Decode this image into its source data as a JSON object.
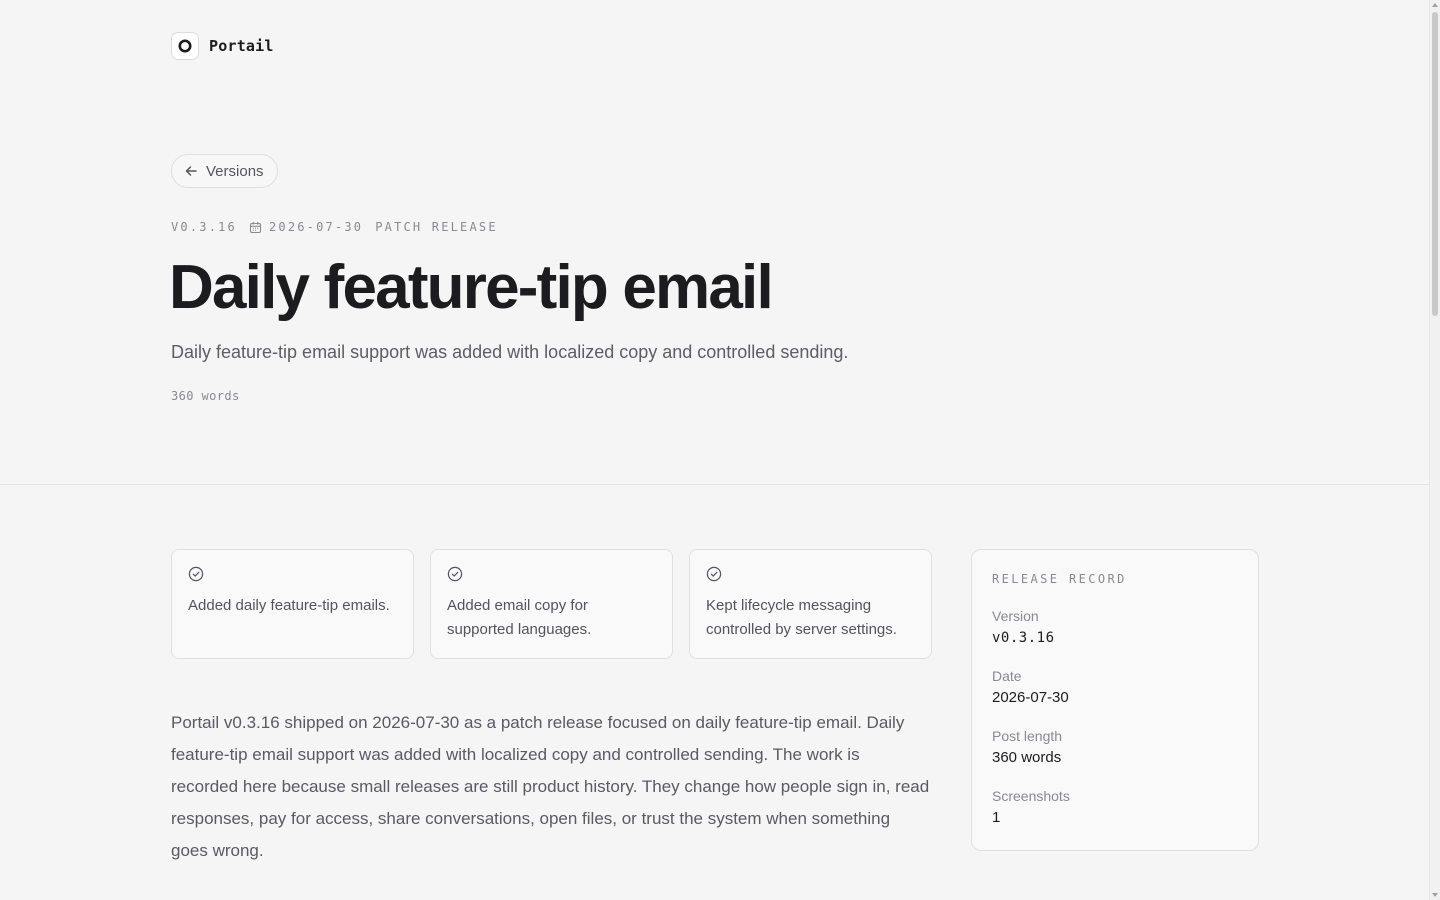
{
  "brand": {
    "name": "Portail",
    "logo_icon": "portail-logo-icon"
  },
  "nav": {
    "back_label": "Versions",
    "back_icon": "arrow-left-icon"
  },
  "meta": {
    "version": "V0.3.16",
    "date": "2026-07-30",
    "date_icon": "calendar-icon",
    "release_type": "PATCH RELEASE"
  },
  "post": {
    "title": "Daily feature-tip email",
    "subtitle": "Daily feature-tip email support was added with localized copy and controlled sending.",
    "word_count": "360 words",
    "body": "Portail v0.3.16 shipped on 2026-07-30 as a patch release focused on daily feature-tip email. Daily feature-tip email support was added with localized copy and controlled sending. The work is recorded here because small releases are still product history. They change how people sign in, read responses, pay for access, share conversations, open files, or trust the system when something goes wrong."
  },
  "highlights": [
    {
      "icon": "check-circle-icon",
      "text": "Added daily feature-tip emails."
    },
    {
      "icon": "check-circle-icon",
      "text": "Added email copy for supported languages."
    },
    {
      "icon": "check-circle-icon",
      "text": "Kept lifecycle messaging controlled by server settings."
    }
  ],
  "record": {
    "title": "RELEASE RECORD",
    "rows": [
      {
        "label": "Version",
        "value": "v0.3.16"
      },
      {
        "label": "Date",
        "value": "2026-07-30"
      },
      {
        "label": "Post length",
        "value": "360 words"
      },
      {
        "label": "Screenshots",
        "value": "1"
      }
    ]
  },
  "colors": {
    "background": "#f5f5f5",
    "text_primary": "#1c1c1e",
    "text_muted": "#8a8a8f",
    "border": "#e0e0e0"
  }
}
